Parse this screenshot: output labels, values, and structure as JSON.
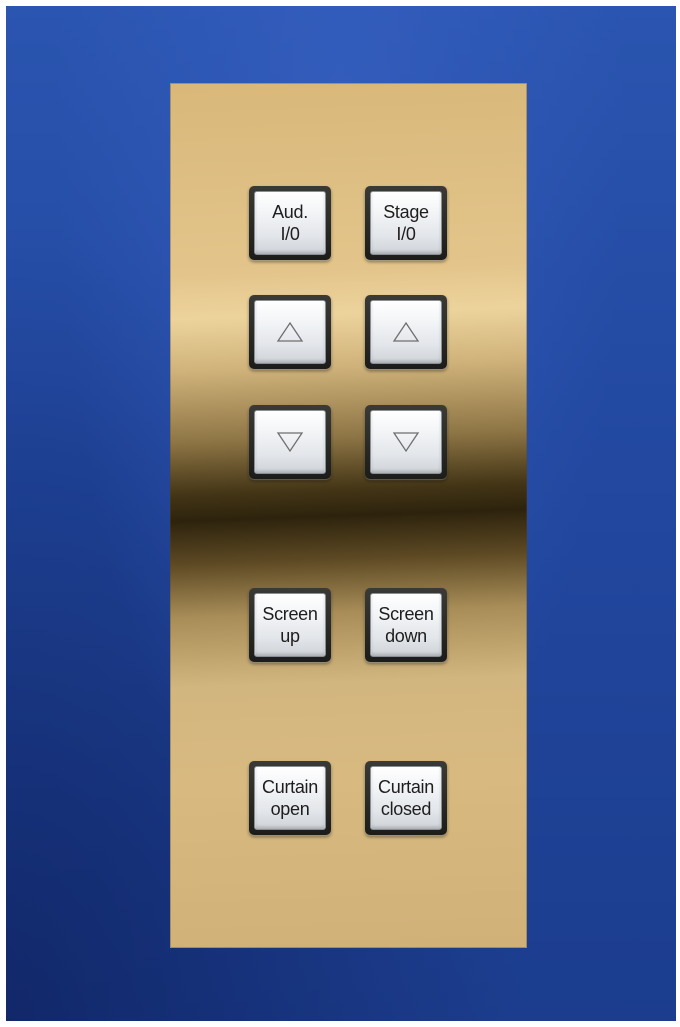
{
  "colors": {
    "background": "#2248a0",
    "panel": "#d8ba80",
    "button_face": "#eef0f2",
    "label_text": "#1e1e1e"
  },
  "buttons": {
    "aud_io": {
      "line1": "Aud.",
      "line2": "I/0"
    },
    "stage_io": {
      "line1": "Stage",
      "line2": "I/0"
    },
    "aud_up": {
      "icon": "up-triangle-icon"
    },
    "stage_up": {
      "icon": "up-triangle-icon"
    },
    "aud_down": {
      "icon": "down-triangle-icon"
    },
    "stage_down": {
      "icon": "down-triangle-icon"
    },
    "screen_up": {
      "line1": "Screen",
      "line2": "up"
    },
    "screen_down": {
      "line1": "Screen",
      "line2": "down"
    },
    "curtain_open": {
      "line1": "Curtain",
      "line2": "open"
    },
    "curtain_closed": {
      "line1": "Curtain",
      "line2": "closed"
    }
  }
}
